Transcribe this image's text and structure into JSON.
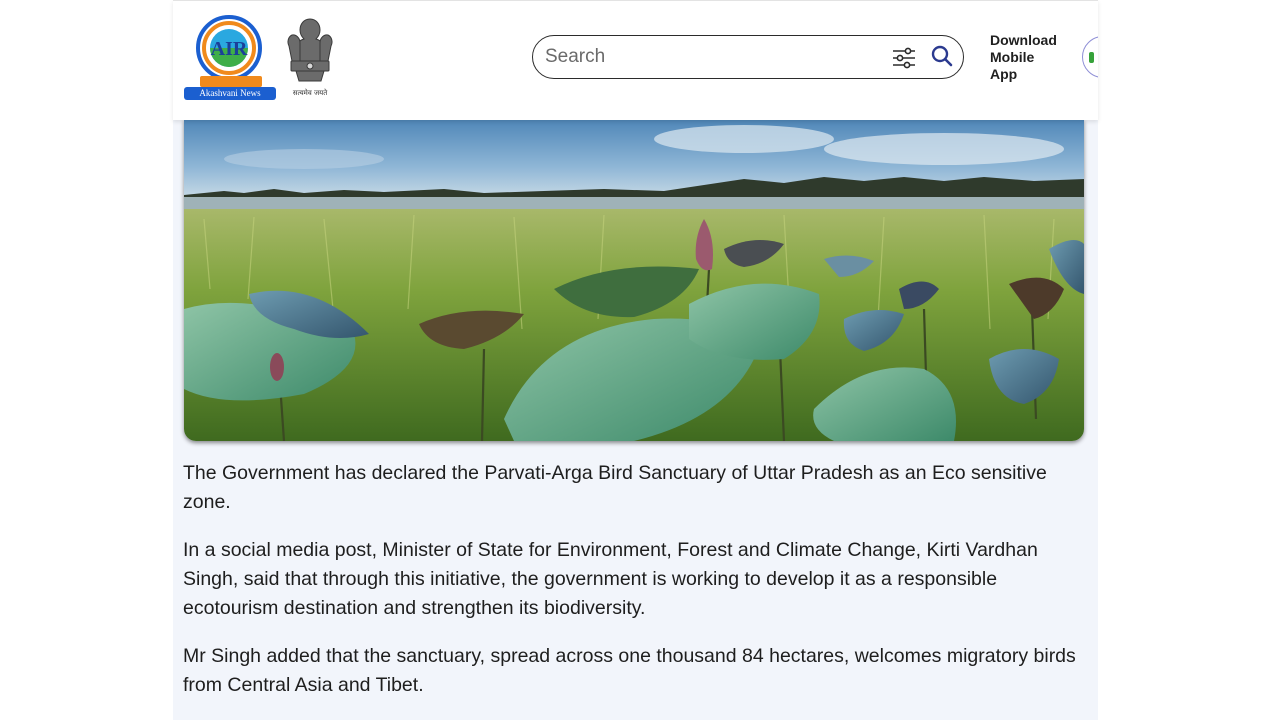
{
  "header": {
    "logo_label": "Akashvani News",
    "logo_ring_text": "AIR",
    "emblem_motto": "सत्यमेव जयते",
    "search": {
      "placeholder": "Search",
      "value": ""
    },
    "download_app_label": "Download\nMobile\nApp"
  },
  "hero": {
    "description": "Lotus leaves and tall grass in a wetland under a blue sky"
  },
  "article": {
    "paragraphs": [
      "The Government has declared the Parvati-Arga Bird Sanctuary of Uttar Pradesh as an Eco sensitive zone.",
      "In a social media post, Minister of State for Environment, Forest and Climate Change, Kirti Vardhan Singh, said that through this initiative, the government is working to develop it as a responsible ecotourism destination and strengthen its biodiversity.",
      "Mr Singh added that the sanctuary, spread across one thousand 84 hectares, welcomes migratory birds from Central Asia and Tibet."
    ]
  },
  "colors": {
    "content_background": "#f2f5fb",
    "logo_blue": "#1b5fd0",
    "logo_orange": "#f08a1c",
    "text": "#1e1e1e"
  }
}
